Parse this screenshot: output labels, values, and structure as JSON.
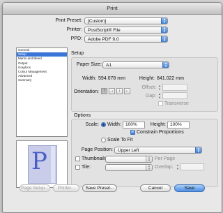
{
  "window": {
    "title": "Print"
  },
  "top": {
    "preset_label": "Print Preset:",
    "preset_value": "[Custom]",
    "printer_label": "Printer:",
    "printer_value": "PostScript® File",
    "ppd_label": "PPD:",
    "ppd_value": "Adobe PDF 9.0"
  },
  "sidebar": {
    "items": [
      "General",
      "Setup",
      "Marks and Bleed",
      "Output",
      "Graphics",
      "Colour Management",
      "Advanced",
      "Summary"
    ],
    "selected_index": 1
  },
  "setup": {
    "section_title": "Setup",
    "paper_size_label": "Paper Size:",
    "paper_size_value": "A1",
    "width_label": "Width:",
    "width_value": "594.078 mm",
    "height_label": "Height:",
    "height_value": "841.022 mm",
    "orientation_label": "Orientation:",
    "offset_label": "Offset:",
    "gap_label": "Gap:",
    "transverse_label": "Transverse"
  },
  "options": {
    "section_title": "Options",
    "scale_label": "Scale:",
    "width_radio_label": "Width:",
    "scale_width": "100%",
    "height_label": "Height:",
    "scale_height": "100%",
    "constrain_label": "Constrain Proportions",
    "constrain_checked": true,
    "scale_to_fit_label": "Scale To Fit",
    "page_position_label": "Page Position:",
    "page_position_value": "Upper Left",
    "thumbnails_label": "Thumbnails:",
    "per_page_label": "Per Page",
    "tile_label": "Tile:",
    "overlap_label": "Overlap:"
  },
  "preview": {
    "letter": "P"
  },
  "buttons": {
    "page_setup": "Page Setup...",
    "printer": "Printer...",
    "save_preset": "Save Preset...",
    "cancel": "Cancel",
    "save": "Save"
  },
  "colors": {
    "accent": "#3875d7",
    "button_default": "#4a8ee5"
  }
}
